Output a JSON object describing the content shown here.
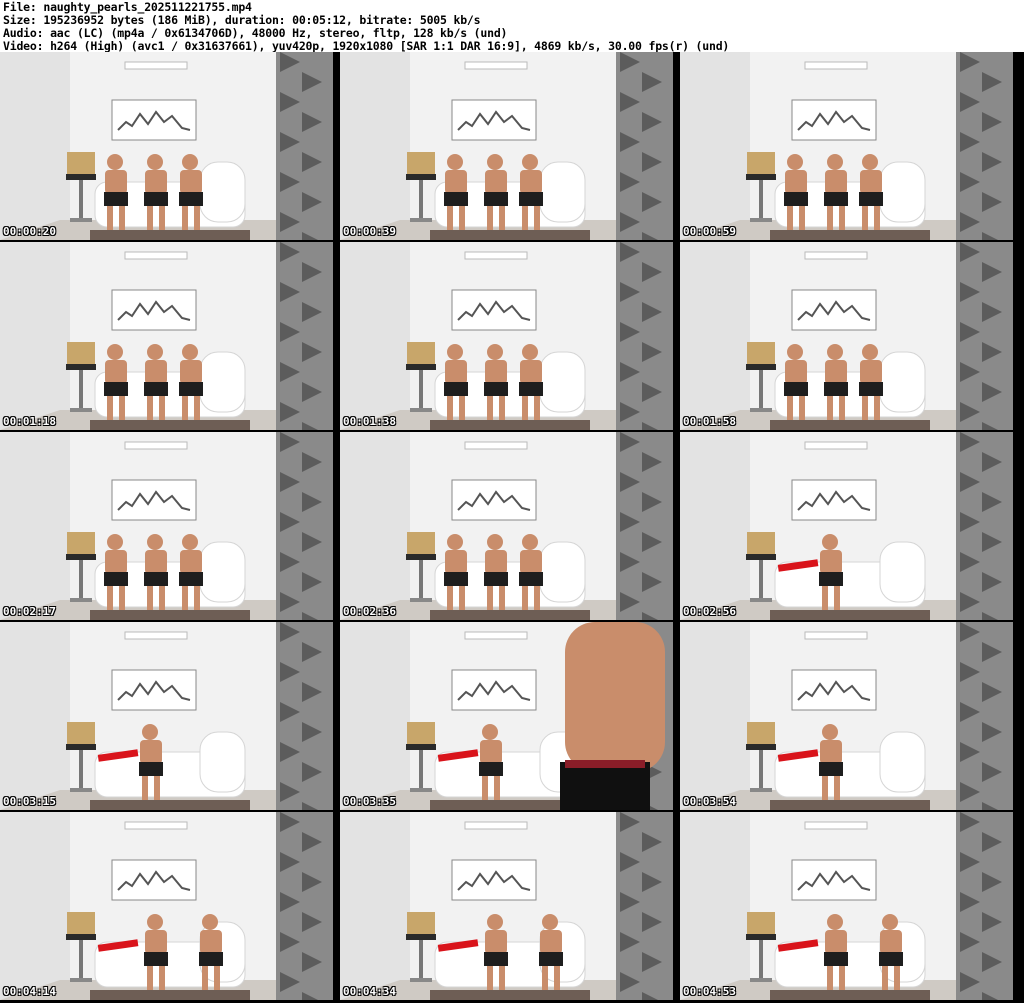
{
  "header": {
    "lines": [
      "File: naughty_pearls_202511221755.mp4",
      "Size: 195236952 bytes (186 MiB), duration: 00:05:12, bitrate: 5005 kb/s",
      "Audio: aac (LC) (mp4a / 0x6134706D), 48000 Hz, stereo, fltp, 128 kb/s (und)",
      "Video: h264 (High) (avc1 / 0x31637661), yuv420p, 1920x1080 [SAR 1:1 DAR 16:9], 4869 kb/s, 30.00 fps(r) (und)"
    ]
  },
  "colors": {
    "wall": "#f2f2f2",
    "curtain": "#8a8a8a",
    "floor": "#cfcac4",
    "rug": "#6e5e55",
    "sofa": "#ffffff",
    "skin": "#c98d6b",
    "shorts": "#1e1e1e",
    "red": "#d9141b",
    "cushion": "#c8a66a",
    "stool": "#2a2a2a"
  },
  "thumbnails": [
    {
      "timestamp": "00:00:20"
    },
    {
      "timestamp": "00:00:39"
    },
    {
      "timestamp": "00:00:59"
    },
    {
      "timestamp": "00:01:18"
    },
    {
      "timestamp": "00:01:38"
    },
    {
      "timestamp": "00:01:58"
    },
    {
      "timestamp": "00:02:17"
    },
    {
      "timestamp": "00:02:36"
    },
    {
      "timestamp": "00:02:56"
    },
    {
      "timestamp": "00:03:15"
    },
    {
      "timestamp": "00:03:35"
    },
    {
      "timestamp": "00:03:54"
    },
    {
      "timestamp": "00:04:14"
    },
    {
      "timestamp": "00:04:34"
    },
    {
      "timestamp": "00:04:53"
    }
  ]
}
